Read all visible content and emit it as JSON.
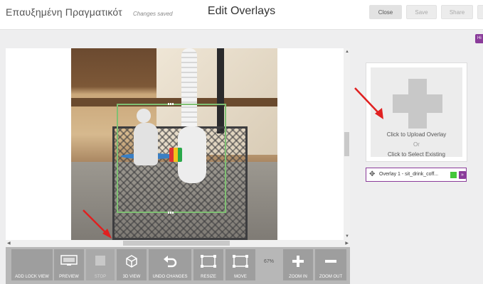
{
  "header": {
    "app_title": "Επαυξημένη Πραγματικότ",
    "status": "Changes saved",
    "page_title": "Edit Overlays",
    "buttons": {
      "close": "Close",
      "save": "Save",
      "share": "Share"
    },
    "side_tab": "Hi"
  },
  "editor": {
    "zoom": "67%"
  },
  "toolbar": {
    "tools": [
      {
        "id": "add-lock-view",
        "label": "ADD LOCK VIEW",
        "icon": "lock-view-icon",
        "enabled": true
      },
      {
        "id": "preview",
        "label": "PREVIEW",
        "icon": "monitor-icon",
        "enabled": true
      },
      {
        "id": "stop",
        "label": "STOP",
        "icon": "stop-icon",
        "enabled": false
      },
      {
        "id": "3d-view",
        "label": "3D VIEW",
        "icon": "cube-icon",
        "enabled": true
      },
      {
        "id": "undo-changes",
        "label": "UNDO CHANGES",
        "icon": "undo-icon",
        "enabled": true
      },
      {
        "id": "resize",
        "label": "RESIZE",
        "icon": "resize-icon",
        "enabled": true
      },
      {
        "id": "move",
        "label": "MOVE",
        "icon": "move-icon",
        "enabled": true
      },
      {
        "id": "zoom-in",
        "label": "ZOOM IN",
        "icon": "plus-icon",
        "enabled": true
      },
      {
        "id": "zoom-out",
        "label": "ZOOM OUT",
        "icon": "minus-icon",
        "enabled": true
      }
    ]
  },
  "sidebar": {
    "upload_label": "Click to Upload Overlay",
    "or_label": "Or",
    "select_label": "Click to Select Existing",
    "overlay_item": {
      "name": "Overlay 1 - sit_drink_coff...",
      "color": "#44c73a"
    }
  },
  "colors": {
    "accent": "#8a3b9a",
    "overlay_border": "#7fbf73",
    "annotation_arrow": "#e02020"
  }
}
